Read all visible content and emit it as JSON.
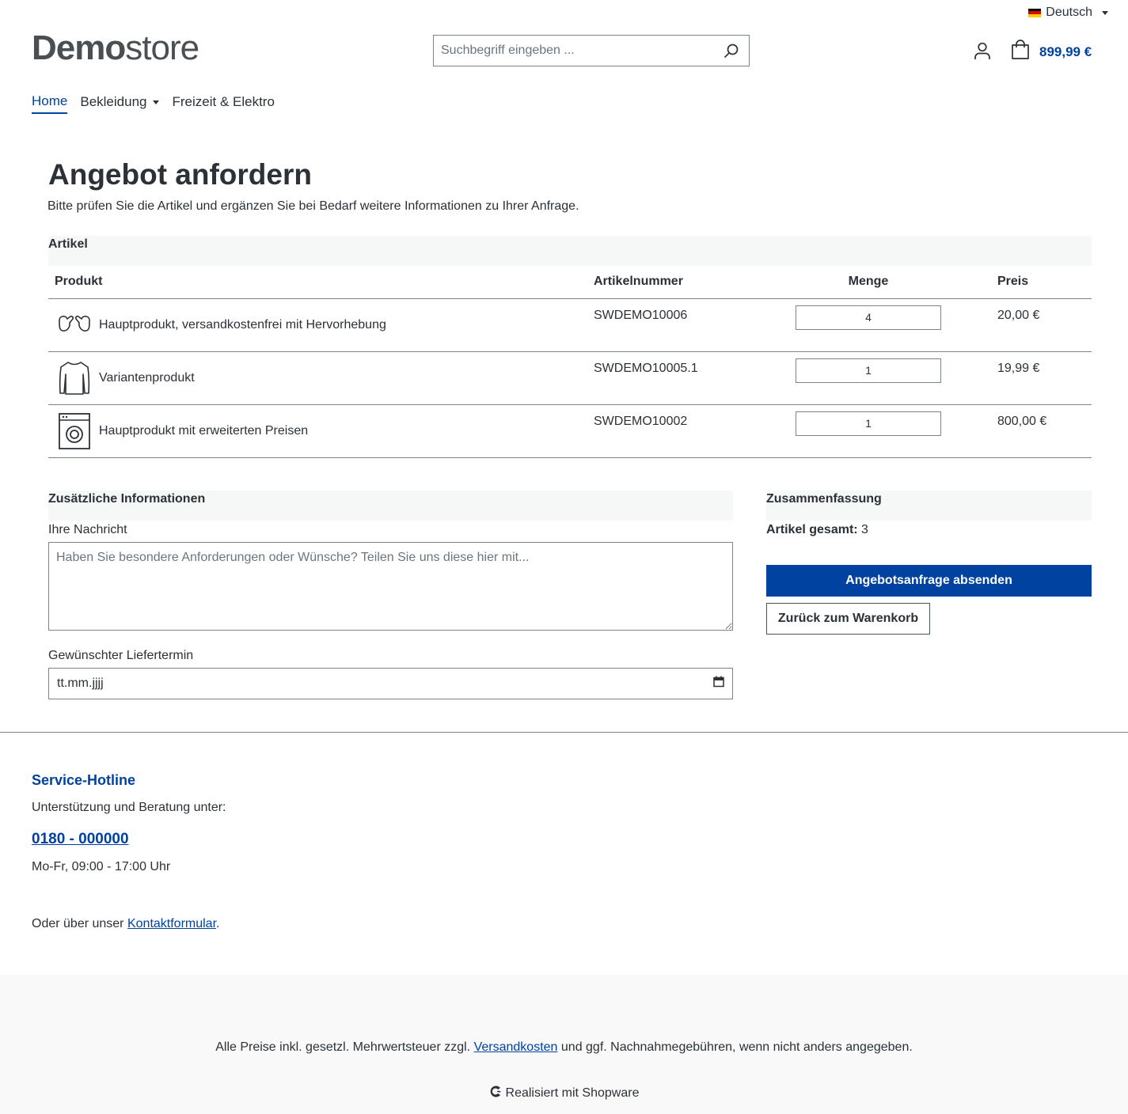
{
  "header": {
    "language": {
      "label": "Deutsch",
      "flag_colors": [
        "#000000",
        "#dd0000",
        "#ffce00"
      ]
    },
    "logo": {
      "bold": "Demo",
      "light": "store"
    },
    "search": {
      "placeholder": "Suchbegriff eingeben ..."
    },
    "cart": {
      "total": "899,99 €"
    }
  },
  "nav": {
    "items": [
      {
        "label": "Home",
        "active": true
      },
      {
        "label": "Bekleidung",
        "dropdown": true
      },
      {
        "label": "Freizeit & Elektro"
      }
    ]
  },
  "page": {
    "title": "Angebot anfordern",
    "subtitle": "Bitte prüfen Sie die Artikel und ergänzen Sie bei Bedarf weitere Informationen zu Ihrer Anfrage."
  },
  "items_section": {
    "heading": "Artikel",
    "columns": [
      "Produkt",
      "Artikelnummer",
      "Menge",
      "Preis"
    ],
    "rows": [
      {
        "icon": "gloves-icon",
        "name": "Hauptprodukt, versandkostenfrei mit Hervorhebung",
        "sku": "SWDEMO10006",
        "qty": "4",
        "price": "20,00 €"
      },
      {
        "icon": "sweater-icon",
        "name": "Variantenprodukt",
        "sku": "SWDEMO10005.1",
        "qty": "1",
        "price": "19,99 €"
      },
      {
        "icon": "washing-machine-icon",
        "name": "Hauptprodukt mit erweiterten Preisen",
        "sku": "SWDEMO10002",
        "qty": "1",
        "price": "800,00 €"
      }
    ]
  },
  "additional": {
    "heading": "Zusätzliche Informationen",
    "message_label": "Ihre Nachricht",
    "message_placeholder": "Haben Sie besondere Anforderungen oder Wünsche? Teilen Sie uns diese hier mit...",
    "date_label": "Gewünschter Liefertermin",
    "date_placeholder": "tt.mm.jjjj"
  },
  "summary": {
    "heading": "Zusammenfassung",
    "total_label": "Artikel gesamt:",
    "total_value": "3",
    "submit_label": "Angebotsanfrage absenden",
    "back_label": "Zurück zum Warenkorb"
  },
  "footer": {
    "hotline_title": "Service-Hotline",
    "hotline_text": "Unterstützung und Beratung unter:",
    "phone": "0180 - 000000",
    "hours": "Mo-Fr, 09:00 - 17:00 Uhr",
    "contact_prefix": "Oder über unser",
    "contact_link": "Kontaktformular",
    "contact_suffix": ".",
    "legal_prefix": "Alle Preise inkl. gesetzl. Mehrwertsteuer zzgl.",
    "legal_link": "Versandkosten",
    "legal_suffix": "und ggf. Nachnahmegebühren, wenn nicht anders angegeben.",
    "powered": "Realisiert mit Shopware"
  },
  "colors": {
    "accent": "#0042a0",
    "text": "#2b3136",
    "border": "#798490",
    "section_bg": "#f6f7f7"
  }
}
